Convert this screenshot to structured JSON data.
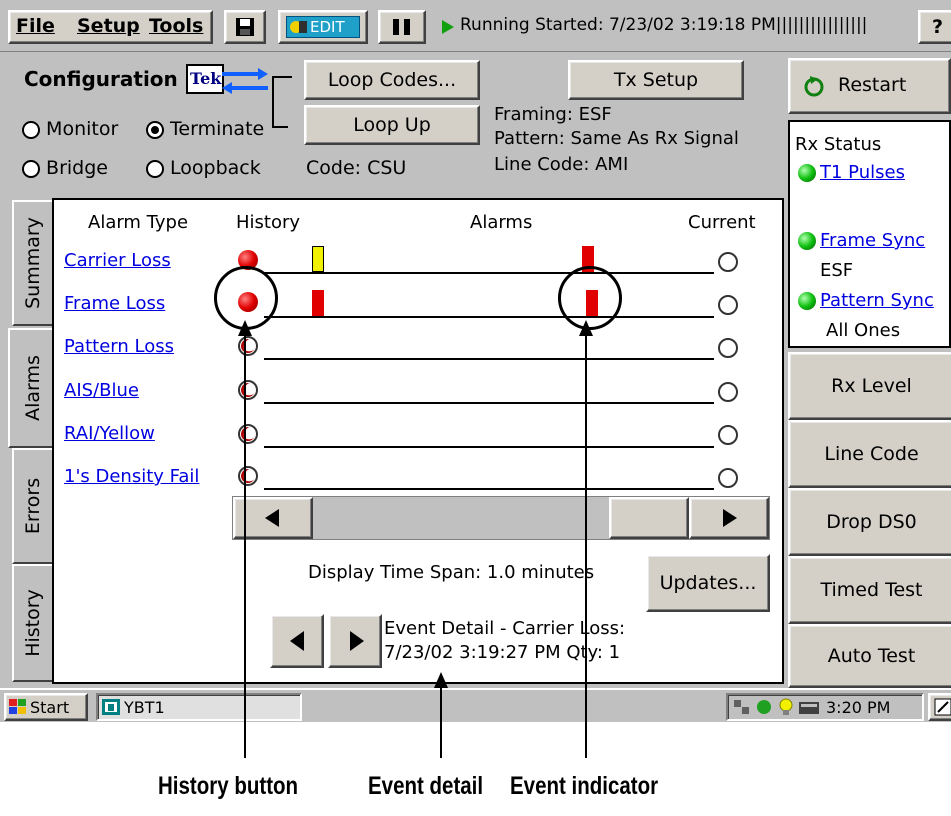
{
  "menubar": {
    "file": "File",
    "setup": "Setup",
    "tools": "Tools",
    "edit_label": "EDIT",
    "status": "Running Started: 7/23/02 3:19:18 PM||||||||||||||||",
    "help": "?"
  },
  "config": {
    "label": "Configuration",
    "tek_logo": "Tek",
    "loop_codes": "Loop Codes...",
    "loop_up": "Loop Up",
    "tx_setup": "Tx Setup",
    "modes": [
      "Monitor",
      "Terminate",
      "Bridge",
      "Loopback"
    ],
    "selected_mode": "Terminate",
    "code": "Code: CSU",
    "framing": "Framing: ESF",
    "pattern": "Pattern: Same As Rx Signal",
    "line_code": "Line Code:  AMI"
  },
  "right_panel": {
    "restart": "Restart",
    "rx_status": "Rx Status",
    "t1_pulses": "T1 Pulses",
    "frame_sync": "Frame Sync",
    "frame_sync_value": "ESF",
    "pattern_sync": "Pattern Sync",
    "pattern_sync_value": "All Ones",
    "buttons": [
      "Rx Level",
      "Line Code",
      "Drop DS0",
      "Timed Test",
      "Auto Test"
    ]
  },
  "tabs": [
    "Summary",
    "Alarms",
    "Errors",
    "History"
  ],
  "alarms": {
    "headers": {
      "type": "Alarm Type",
      "history": "History",
      "alarms": "Alarms",
      "current": "Current"
    },
    "rows": [
      {
        "name": "Carrier Loss",
        "history": "red"
      },
      {
        "name": "Frame Loss",
        "history": "red"
      },
      {
        "name": "Pattern Loss",
        "history": "off"
      },
      {
        "name": "AIS/Blue",
        "history": "off"
      },
      {
        "name": "RAI/Yellow",
        "history": "off"
      },
      {
        "name": "1's Density Fail",
        "history": "off"
      }
    ],
    "time_span": "Display Time Span: 1.0 minutes",
    "updates": "Updates...",
    "event_line1": "Event Detail - Carrier Loss:",
    "event_line2": "7/23/02 3:19:27 PM Qty: 1"
  },
  "taskbar": {
    "start": "Start",
    "task": "YBT1",
    "clock": "3:20 PM"
  },
  "callouts": {
    "history_button": "History button",
    "event_detail": "Event detail",
    "event_indicator": "Event indicator"
  },
  "colors": {
    "alarm_red": "#e00000",
    "warn_yellow": "#f0f000",
    "link_blue": "#0000e0",
    "led_green": "#10c010"
  }
}
